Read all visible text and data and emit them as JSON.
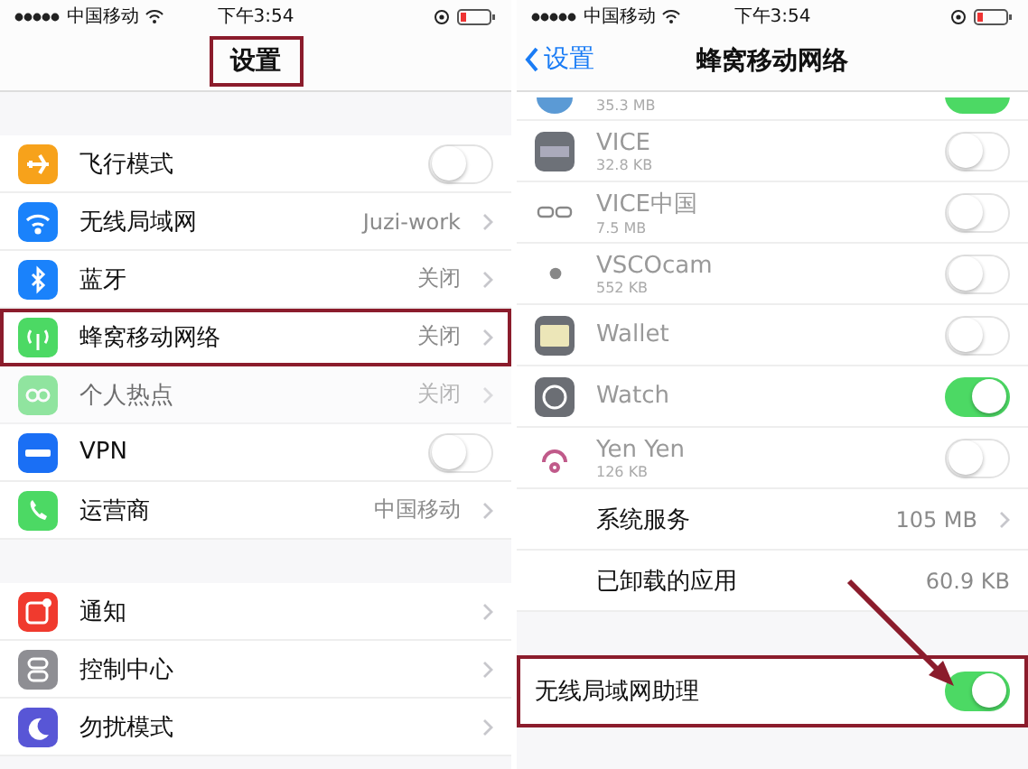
{
  "left": {
    "status_bar": {
      "carrier": "中国移动",
      "time": "下午3:54"
    },
    "nav": {
      "title": "设置",
      "highlighted": true
    },
    "groups": [
      [
        {
          "label": "飞行模式",
          "kind": "toggle",
          "on": false,
          "disabled": false,
          "highlighted": false
        },
        {
          "label": "无线局域网",
          "kind": "link",
          "value": "Juzi-work",
          "disabled": false,
          "highlighted": false
        },
        {
          "label": "蓝牙",
          "kind": "link",
          "value": "关闭",
          "disabled": false,
          "highlighted": false
        },
        {
          "label": "蜂窝移动网络",
          "kind": "link",
          "value": "关闭",
          "disabled": false,
          "highlighted": true
        },
        {
          "label": "个人热点",
          "kind": "link",
          "value": "关闭",
          "disabled": true,
          "highlighted": false
        },
        {
          "label": "VPN",
          "kind": "toggle",
          "on": false,
          "disabled": false,
          "highlighted": false
        },
        {
          "label": "运营商",
          "kind": "link",
          "value": "中国移动",
          "disabled": false,
          "highlighted": false
        }
      ],
      [
        {
          "label": "通知",
          "kind": "link",
          "disabled": false,
          "highlighted": false
        },
        {
          "label": "控制中心",
          "kind": "link",
          "disabled": false,
          "highlighted": false
        },
        {
          "label": "勿扰模式",
          "kind": "link",
          "disabled": false,
          "highlighted": false
        }
      ]
    ]
  },
  "right": {
    "status_bar": {
      "carrier": "中国移动",
      "time": "下午3:54"
    },
    "nav": {
      "back": "设置",
      "title": "蜂窝移动网络"
    },
    "apps": [
      {
        "kind": "partial",
        "size": "35.3 MB",
        "on": true
      },
      {
        "kind": "app",
        "name": "VICE",
        "size": "32.8 KB",
        "on": false
      },
      {
        "kind": "app",
        "name": "VICE中国",
        "size": "7.5 MB",
        "on": false
      },
      {
        "kind": "app",
        "name": "VSCOcam",
        "size": "552 KB",
        "on": false
      },
      {
        "kind": "app",
        "name": "Wallet",
        "on": false
      },
      {
        "kind": "app",
        "name": "Watch",
        "on": true
      },
      {
        "kind": "app",
        "name": "Yen Yen",
        "size": "126 KB",
        "on": false
      },
      {
        "kind": "info",
        "name": "系统服务",
        "value": "105 MB",
        "chevron": true
      },
      {
        "kind": "info",
        "name": "已卸载的应用",
        "value": "60.9 KB",
        "chevron": false
      }
    ],
    "assist": {
      "label": "无线局域网助理",
      "on": true,
      "highlighted": true,
      "arrow": true
    }
  }
}
